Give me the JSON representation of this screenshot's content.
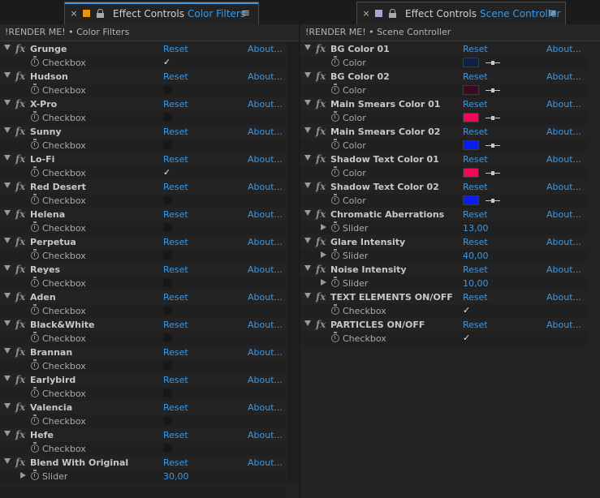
{
  "left": {
    "tab": {
      "close": "×",
      "swatch_color": "#e8960c",
      "title": "Effect Controls",
      "subtitle": "Color Filters",
      "menu": "≡"
    },
    "breadcrumb": "!RENDER ME! • Color Filters",
    "effects": [
      {
        "name": "Grunge",
        "reset": "Reset",
        "about": "About...",
        "prop": "Checkbox",
        "kind": "checkbox",
        "checked": true
      },
      {
        "name": "Hudson",
        "reset": "Reset",
        "about": "About...",
        "prop": "Checkbox",
        "kind": "checkbox",
        "checked": false
      },
      {
        "name": "X-Pro",
        "reset": "Reset",
        "about": "About...",
        "prop": "Checkbox",
        "kind": "checkbox",
        "checked": false
      },
      {
        "name": "Sunny",
        "reset": "Reset",
        "about": "About...",
        "prop": "Checkbox",
        "kind": "checkbox",
        "checked": false
      },
      {
        "name": "Lo-Fi",
        "reset": "Reset",
        "about": "About...",
        "prop": "Checkbox",
        "kind": "checkbox",
        "checked": true
      },
      {
        "name": "Red Desert",
        "reset": "Reset",
        "about": "About...",
        "prop": "Checkbox",
        "kind": "checkbox",
        "checked": false
      },
      {
        "name": "Helena",
        "reset": "Reset",
        "about": "About...",
        "prop": "Checkbox",
        "kind": "checkbox",
        "checked": false
      },
      {
        "name": "Perpetua",
        "reset": "Reset",
        "about": "About...",
        "prop": "Checkbox",
        "kind": "checkbox",
        "checked": false
      },
      {
        "name": "Reyes",
        "reset": "Reset",
        "about": "About...",
        "prop": "Checkbox",
        "kind": "checkbox",
        "checked": false
      },
      {
        "name": "Aden",
        "reset": "Reset",
        "about": "About...",
        "prop": "Checkbox",
        "kind": "checkbox",
        "checked": false
      },
      {
        "name": "Black&White",
        "reset": "Reset",
        "about": "About...",
        "prop": "Checkbox",
        "kind": "checkbox",
        "checked": false
      },
      {
        "name": "Brannan",
        "reset": "Reset",
        "about": "About...",
        "prop": "Checkbox",
        "kind": "checkbox",
        "checked": false
      },
      {
        "name": "Earlybird",
        "reset": "Reset",
        "about": "About...",
        "prop": "Checkbox",
        "kind": "checkbox",
        "checked": false
      },
      {
        "name": "Valencia",
        "reset": "Reset",
        "about": "About...",
        "prop": "Checkbox",
        "kind": "checkbox",
        "checked": false
      },
      {
        "name": "Hefe",
        "reset": "Reset",
        "about": "About...",
        "prop": "Checkbox",
        "kind": "checkbox",
        "checked": false
      },
      {
        "name": "Blend With Original",
        "reset": "Reset",
        "about": "About...",
        "prop": "Slider",
        "kind": "slider",
        "value": "30,00"
      }
    ]
  },
  "right": {
    "tab": {
      "close": "×",
      "swatch_color": "#a9a6d2",
      "title": "Effect Controls",
      "subtitle": "Scene Controller",
      "menu": "≡"
    },
    "breadcrumb": "!RENDER ME! • Scene Controller",
    "effects": [
      {
        "name": "BG Color 01",
        "reset": "Reset",
        "about": "About...",
        "prop": "Color",
        "kind": "color",
        "color": "#0b2148"
      },
      {
        "name": "BG Color 02",
        "reset": "Reset",
        "about": "About...",
        "prop": "Color",
        "kind": "color",
        "color": "#3a0a24"
      },
      {
        "name": "Main Smears Color 01",
        "reset": "Reset",
        "about": "About...",
        "prop": "Color",
        "kind": "color",
        "color": "#f0085a"
      },
      {
        "name": "Main Smears Color 02",
        "reset": "Reset",
        "about": "About...",
        "prop": "Color",
        "kind": "color",
        "color": "#0a1cf0"
      },
      {
        "name": "Shadow Text Color 01",
        "reset": "Reset",
        "about": "About...",
        "prop": "Color",
        "kind": "color",
        "color": "#f0085a"
      },
      {
        "name": "Shadow Text Color 02",
        "reset": "Reset",
        "about": "About...",
        "prop": "Color",
        "kind": "color",
        "color": "#0a1cf0"
      },
      {
        "name": "Chromatic Aberrations",
        "reset": "Reset",
        "about": "About...",
        "prop": "Slider",
        "kind": "slider",
        "value": "13,00"
      },
      {
        "name": "Glare Intensity",
        "reset": "Reset",
        "about": "About...",
        "prop": "Slider",
        "kind": "slider",
        "value": "40,00"
      },
      {
        "name": "Noise Intensity",
        "reset": "Reset",
        "about": "About...",
        "prop": "Slider",
        "kind": "slider",
        "value": "10,00"
      },
      {
        "name": "TEXT ELEMENTS ON/OFF",
        "reset": "Reset",
        "about": "About...",
        "prop": "Checkbox",
        "kind": "checkbox",
        "checked": true
      },
      {
        "name": "PARTICLES ON/OFF",
        "reset": "Reset",
        "about": "About...",
        "prop": "Checkbox",
        "kind": "checkbox",
        "checked": true
      }
    ]
  }
}
